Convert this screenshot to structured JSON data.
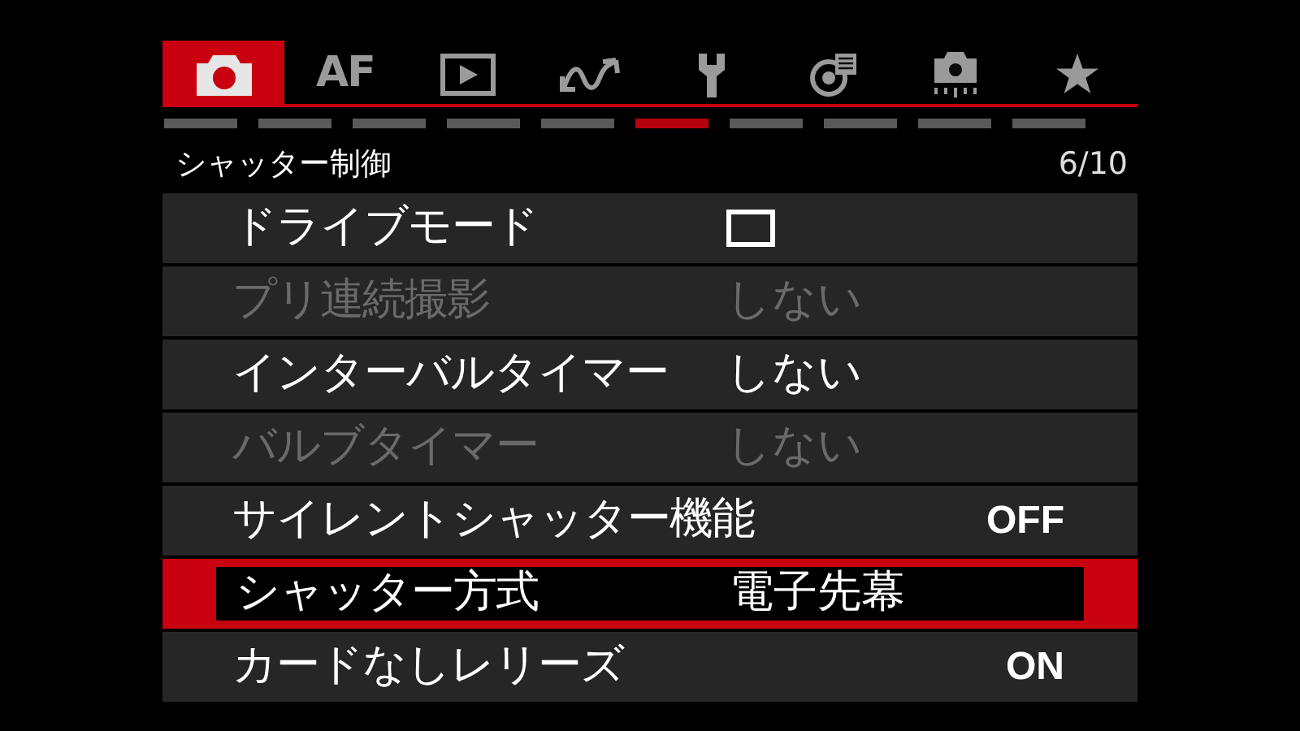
{
  "tabs": [
    {
      "kind": "camera",
      "selected": true
    },
    {
      "kind": "text",
      "label": "AF",
      "selected": false
    },
    {
      "kind": "play",
      "selected": false
    },
    {
      "kind": "wave",
      "selected": false
    },
    {
      "kind": "wrench",
      "selected": false
    },
    {
      "kind": "chart",
      "selected": false
    },
    {
      "kind": "camera-custom",
      "selected": false
    },
    {
      "kind": "star",
      "selected": false
    }
  ],
  "pages": [
    {
      "selected": false
    },
    {
      "selected": false
    },
    {
      "selected": false
    },
    {
      "selected": false
    },
    {
      "selected": false
    },
    {
      "selected": true
    },
    {
      "selected": false
    },
    {
      "selected": false
    },
    {
      "selected": false
    },
    {
      "selected": false
    }
  ],
  "header": {
    "title": "シャッター制御",
    "page": "6/10"
  },
  "rows": [
    {
      "label": "ドライブモード",
      "kind": "icon",
      "disabled": false,
      "selected": false
    },
    {
      "label": "プリ連続撮影",
      "value": "しない",
      "kind": "text",
      "disabled": true,
      "selected": false
    },
    {
      "label": "インターバルタイマー",
      "value": "しない",
      "kind": "text",
      "disabled": false,
      "selected": false
    },
    {
      "label": "バルブタイマー",
      "value": "しない",
      "kind": "text",
      "disabled": true,
      "selected": false
    },
    {
      "label": "サイレントシャッター機能",
      "value": "OFF",
      "kind": "switch",
      "disabled": false,
      "selected": false
    },
    {
      "label": "シャッター方式",
      "value": "電子先幕",
      "kind": "text",
      "disabled": false,
      "selected": true
    },
    {
      "label": "カードなしレリーズ",
      "value": "ON",
      "kind": "switch",
      "disabled": false,
      "selected": false
    }
  ]
}
